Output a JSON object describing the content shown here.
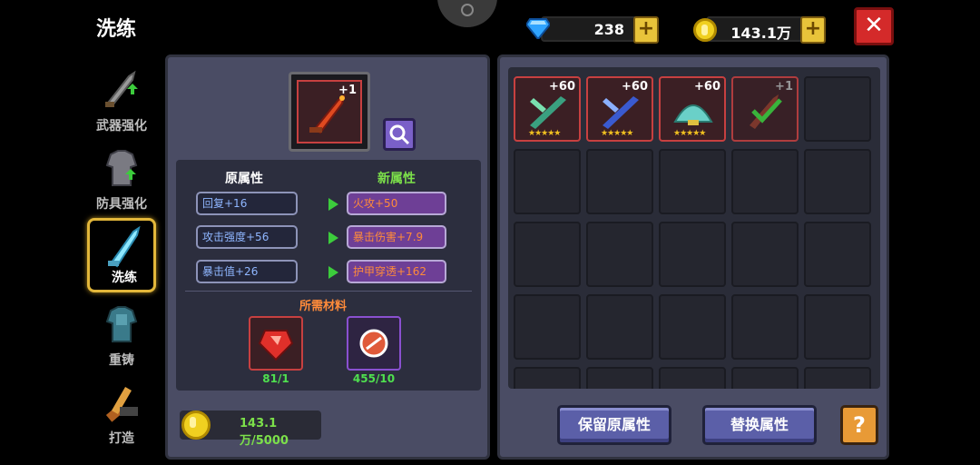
{
  "page": {
    "title": "洗练"
  },
  "currency": {
    "gems": "238",
    "gold": "143.1万"
  },
  "nav": [
    {
      "label": "武器强化",
      "icon": "sword-upgrade-icon"
    },
    {
      "label": "防具强化",
      "icon": "armor-upgrade-icon"
    },
    {
      "label": "洗练",
      "icon": "crystal-sword-icon",
      "active": true
    },
    {
      "label": "重铸",
      "icon": "armor-reforge-icon"
    },
    {
      "label": "打造",
      "icon": "hammer-craft-icon"
    }
  ],
  "selected_item": {
    "plus": "+1"
  },
  "attributes": {
    "old_header": "原属性",
    "new_header": "新属性",
    "old": [
      "回复+16",
      "攻击强度+56",
      "暴击值+26"
    ],
    "new": [
      "火攻+50",
      "暴击伤害+7.9",
      "护甲穿透+162"
    ]
  },
  "materials": {
    "header": "所需材料",
    "items": [
      {
        "count": "81/1",
        "icon": "red-gem-icon"
      },
      {
        "count": "455/10",
        "icon": "scroll-orb-icon"
      }
    ]
  },
  "cost": {
    "gold": "143.1万/5000"
  },
  "inventory": [
    {
      "plus": "+60",
      "icon": "green-crossbow-icon",
      "stars": "★★★★★"
    },
    {
      "plus": "+60",
      "icon": "blue-crossbow-icon",
      "stars": "★★★★★"
    },
    {
      "plus": "+60",
      "icon": "teal-shell-icon",
      "stars": "★★★★★"
    },
    {
      "plus": "+1",
      "icon": "flame-sword-icon",
      "selected": true
    }
  ],
  "buttons": {
    "keep": "保留原属性",
    "replace": "替换属性",
    "help": "?"
  },
  "colors": {
    "accent_gold": "#e3b73a",
    "panel": "#4a4c64",
    "close": "#d42a2a",
    "new_attr": "#ff8b3a",
    "old_attr": "#8fb6ff"
  }
}
